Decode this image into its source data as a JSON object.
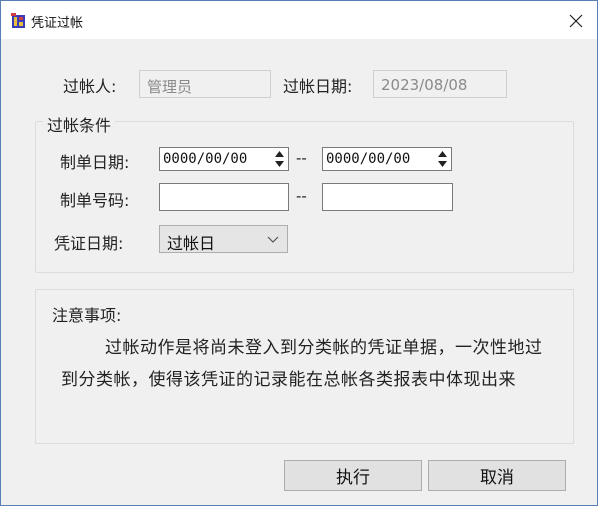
{
  "window": {
    "title": "凭证过帐",
    "close_label": "×"
  },
  "header": {
    "poster_label": "过帐人:",
    "poster_value": "管理员",
    "post_date_label": "过帐日期:",
    "post_date_value": "2023/08/08"
  },
  "conditions": {
    "legend": "过帐条件",
    "doc_date_label": "制单日期:",
    "doc_date_from": "0000/00/00",
    "doc_date_sep": "--",
    "doc_date_to": "0000/00/00",
    "doc_no_label": "制单号码:",
    "doc_no_from": "",
    "doc_no_sep": "--",
    "doc_no_to": "",
    "voucher_date_label": "凭证日期:",
    "voucher_date_selected": "过帐日"
  },
  "notes": {
    "title": "注意事项:",
    "body": "过帐动作是将尚未登入到分类帐的凭证单据，一次性地过到分类帐，使得该凭证的记录能在总帐各类报表中体现出来"
  },
  "buttons": {
    "execute": "执行",
    "cancel": "取消"
  }
}
